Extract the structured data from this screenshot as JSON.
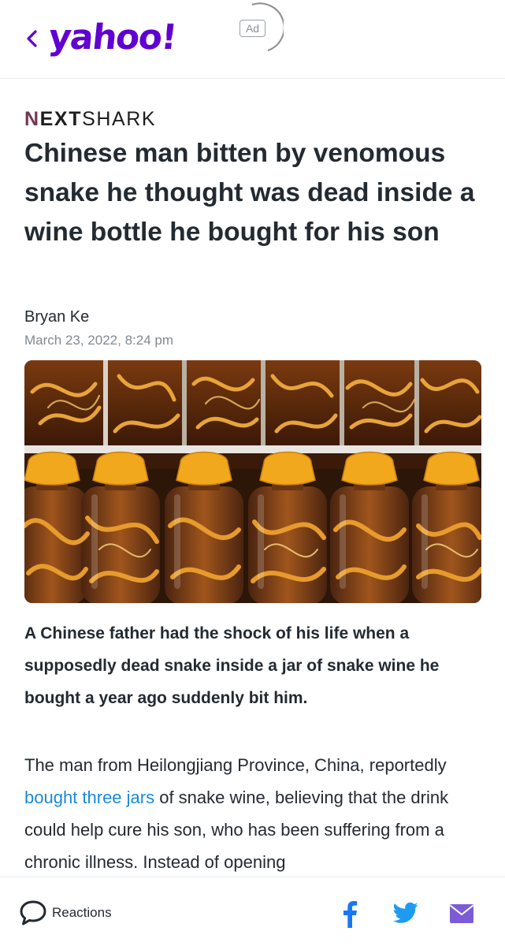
{
  "header": {
    "logo": "yahoo!",
    "ad_label": "Ad"
  },
  "article": {
    "publisher": {
      "first_letter": "N",
      "rest_bold": "EXT",
      "rest": "SHARK"
    },
    "headline": "Chinese man bitten by venomous snake he thought was dead inside a wine bottle he bought for his son",
    "author": "Bryan Ke",
    "date": "March 23, 2022, 8:24 pm",
    "summary": "A Chinese father had the shock of his life when a supposedly dead snake inside a jar of snake wine he bought a year ago suddenly bit him.",
    "body_before_link": "The man from Heilongjiang Province, China, reportedly ",
    "body_link": "bought three jars",
    "body_after_link": " of snake wine, believing that the drink could help cure his son, who has been suffering from a chronic illness. Instead of opening"
  },
  "footer": {
    "reactions_label": "Reactions"
  },
  "colors": {
    "yahoo_purple": "#6001d2",
    "link_blue": "#1a8ad8",
    "facebook_blue": "#1877f2",
    "twitter_blue": "#1d9bf0",
    "mail_purple": "#7b5cd6"
  },
  "icons": [
    "back-chevron-icon",
    "chat-bubble-icon",
    "facebook-icon",
    "twitter-icon",
    "mail-icon"
  ]
}
